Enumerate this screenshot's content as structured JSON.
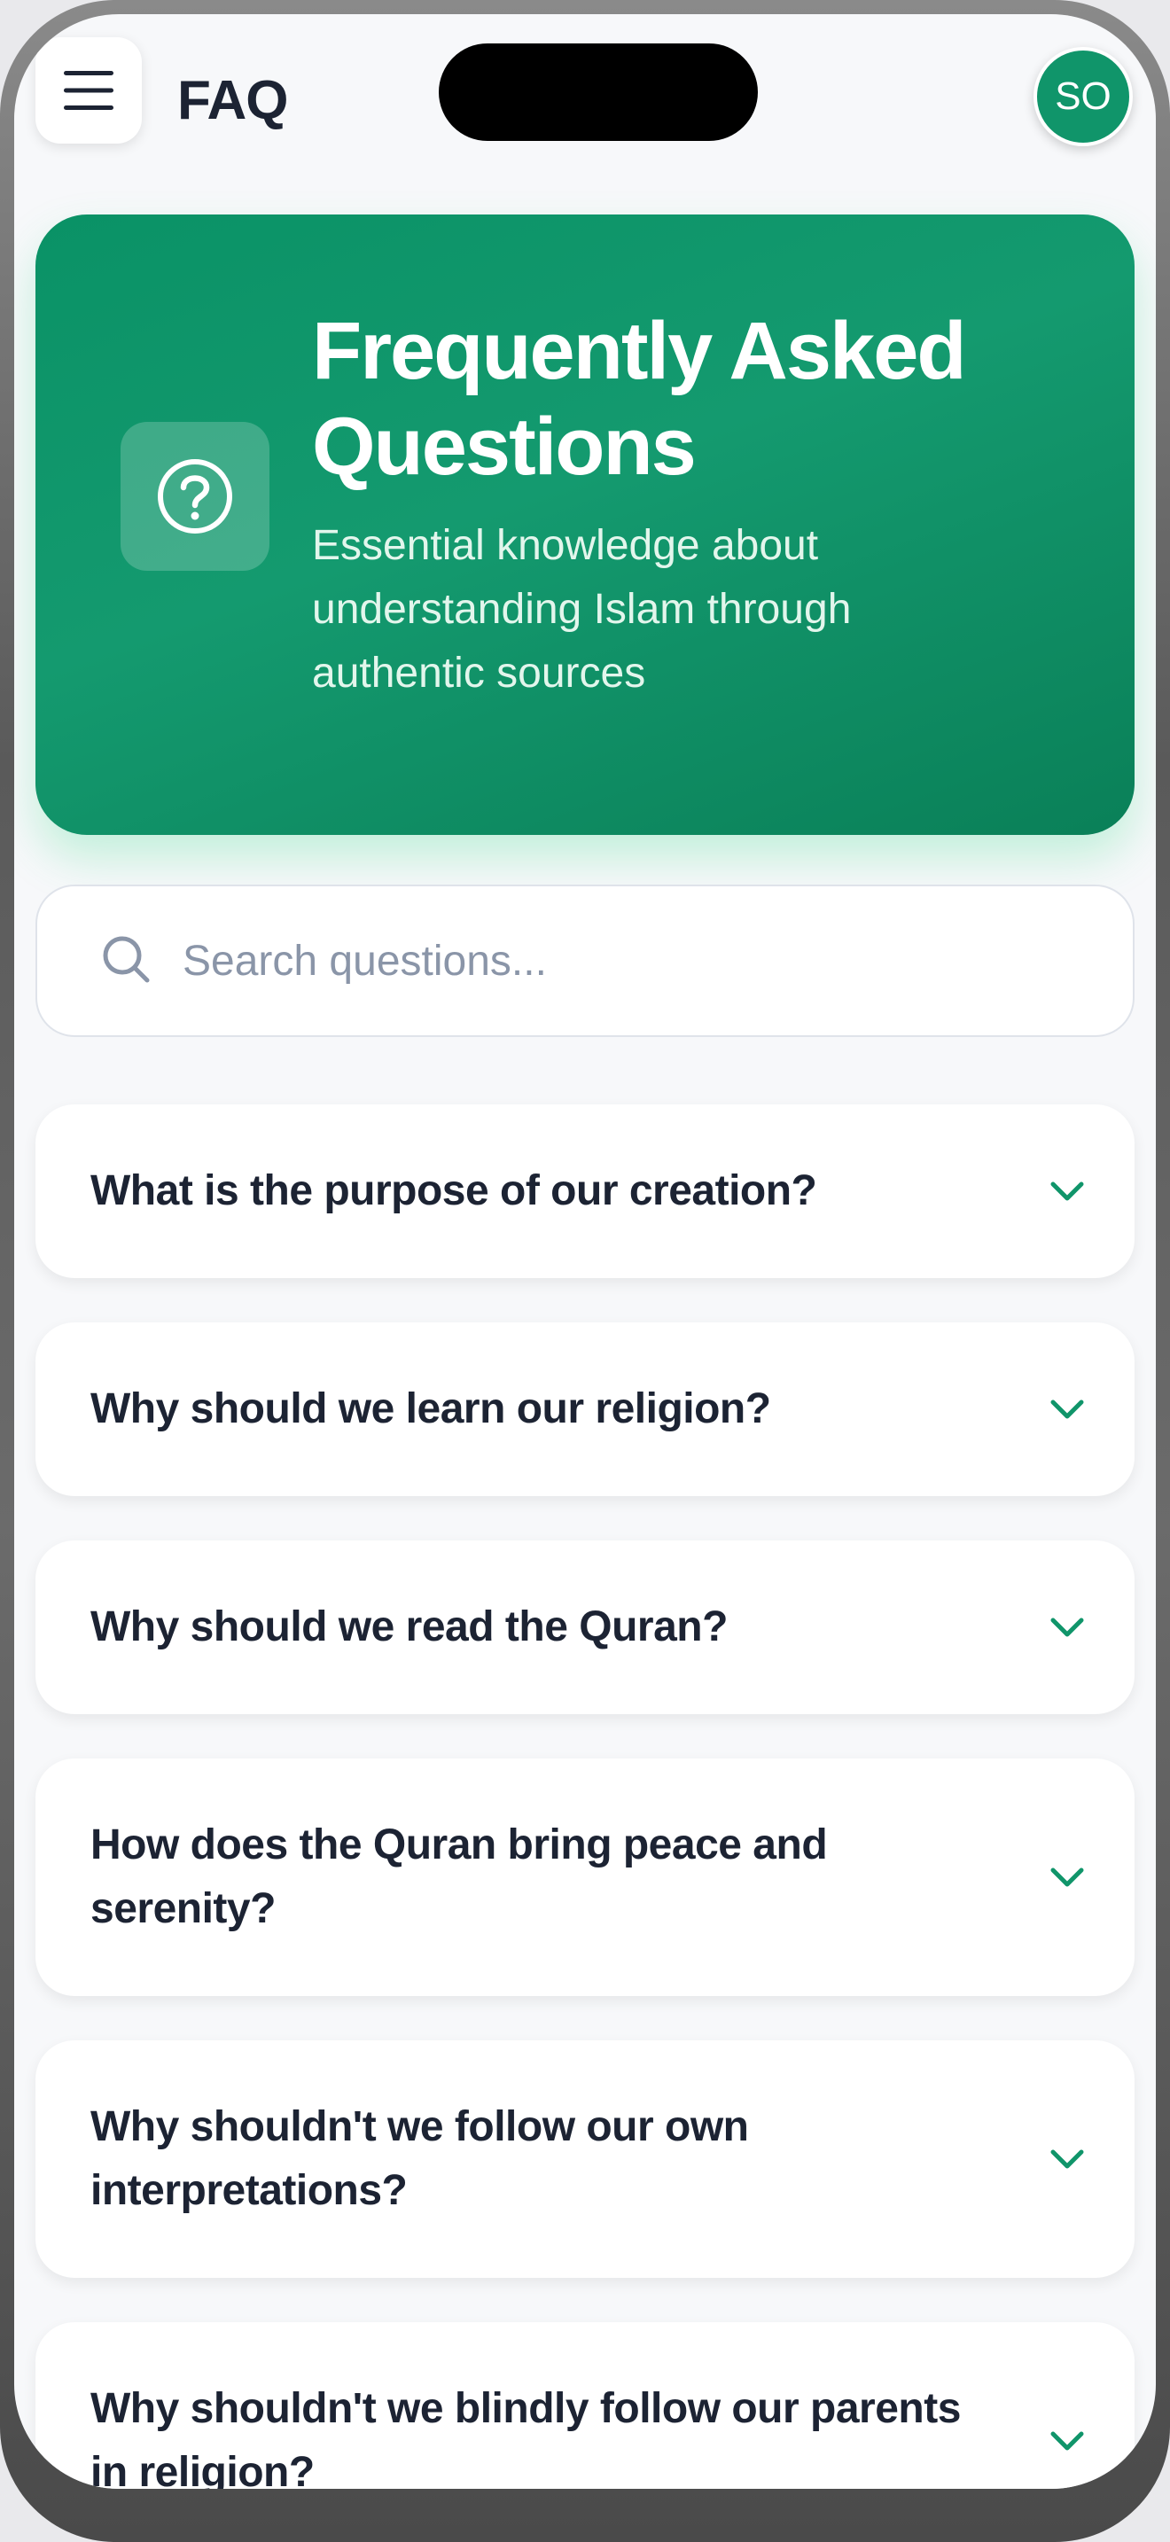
{
  "header": {
    "menu_icon": "hamburger-icon",
    "title": "FAQ",
    "avatar_initials": "SO"
  },
  "hero": {
    "icon": "question-circle-icon",
    "title": "Frequently Asked Questions",
    "subtitle": "Essential knowledge about understanding Islam through authentic sources"
  },
  "search": {
    "icon": "search-icon",
    "placeholder": "Search questions...",
    "value": ""
  },
  "faqs": [
    {
      "question": "What is the purpose of our creation?"
    },
    {
      "question": "Why should we learn our religion?"
    },
    {
      "question": "Why should we read the Quran?"
    },
    {
      "question": "How does the Quran bring peace and serenity?"
    },
    {
      "question": "Why shouldn't we follow our own interpretations?"
    },
    {
      "question": "Why shouldn't we blindly follow our parents in religion?"
    }
  ],
  "colors": {
    "accent": "#10956a",
    "title_text": "#1c2333",
    "placeholder": "#8a95a8",
    "background": "#f7f8fa"
  }
}
